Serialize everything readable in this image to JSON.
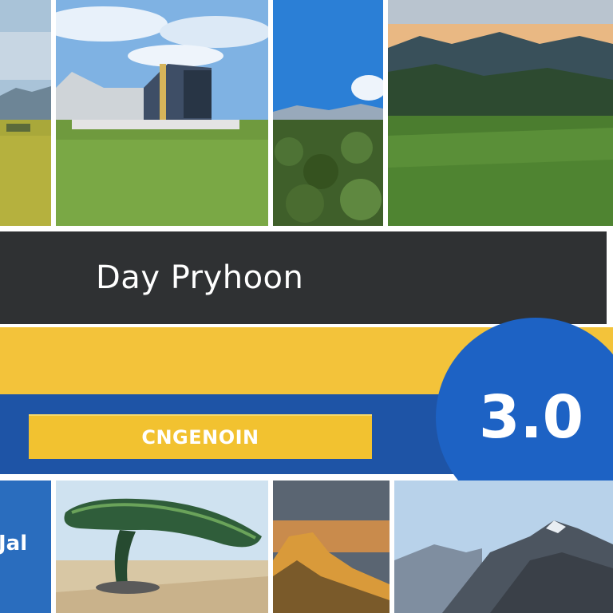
{
  "banner": {
    "title": "Day Pryhoon",
    "subtitle": "CNGENOIN",
    "version": "3.0"
  },
  "side_tile": {
    "label": "Jal"
  },
  "colors": {
    "title_bg": "#2f3133",
    "yellow": "#f3c33a",
    "blue_band": "#1e54a6",
    "badge_blue": "#1d62c4"
  }
}
